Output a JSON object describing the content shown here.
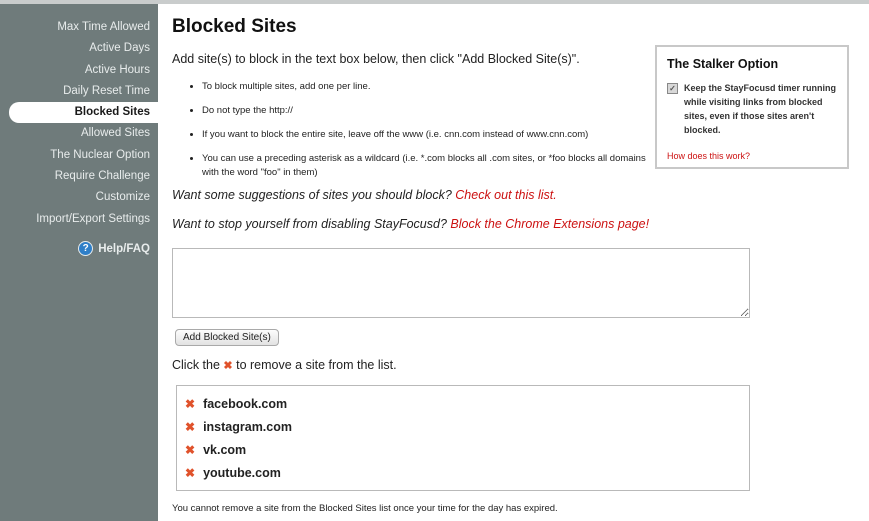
{
  "sidebar": {
    "items": [
      {
        "label": "Max Time Allowed"
      },
      {
        "label": "Active Days"
      },
      {
        "label": "Active Hours"
      },
      {
        "label": "Daily Reset Time"
      },
      {
        "label": "Blocked Sites"
      },
      {
        "label": "Allowed Sites"
      },
      {
        "label": "The Nuclear Option"
      },
      {
        "label": "Require Challenge"
      },
      {
        "label": "Customize"
      },
      {
        "label": "Import/Export Settings"
      }
    ],
    "active_item": "Blocked Sites",
    "help_label": "Help/FAQ",
    "help_icon": "question-circle-icon"
  },
  "main": {
    "title": "Blocked Sites",
    "intro": "Add site(s) to block in the text box below, then click \"Add Blocked Site(s)\".",
    "bullets": [
      "To block multiple sites, add one per line.",
      "Do not type the http://",
      "If you want to block the entire site, leave off the www (i.e. cnn.com instead of www.cnn.com)",
      "You can use a preceding asterisk as a wildcard (i.e. *.com blocks all .com sites, or *foo blocks all domains with the word \"foo\" in them)"
    ],
    "suggest1": {
      "text": "Want some suggestions of sites you should block?",
      "link": "Check out this list."
    },
    "suggest2": {
      "text": "Want to stop yourself from disabling StayFocusd?",
      "link": "Block the Chrome Extensions page!"
    },
    "textbox_value": "",
    "add_button": "Add Blocked Site(s)",
    "remove_note": {
      "before": "Click the",
      "after": "to remove a site from the list."
    },
    "blocked_sites": [
      "facebook.com",
      "instagram.com",
      "vk.com",
      "youtube.com"
    ],
    "footer": "You cannot remove a site from the Blocked Sites list once your time for the day has expired."
  },
  "stalker": {
    "title": "The Stalker Option",
    "checkbox_checked": true,
    "checkbox_label": "Keep the StayFocusd timer running while visiting links from blocked sites, even if those sites aren't blocked.",
    "link": "How does this work?"
  },
  "colors": {
    "sidebar_bg": "#6f7b7b",
    "link_red": "#cc1111",
    "remove_x": "#e0522b"
  }
}
